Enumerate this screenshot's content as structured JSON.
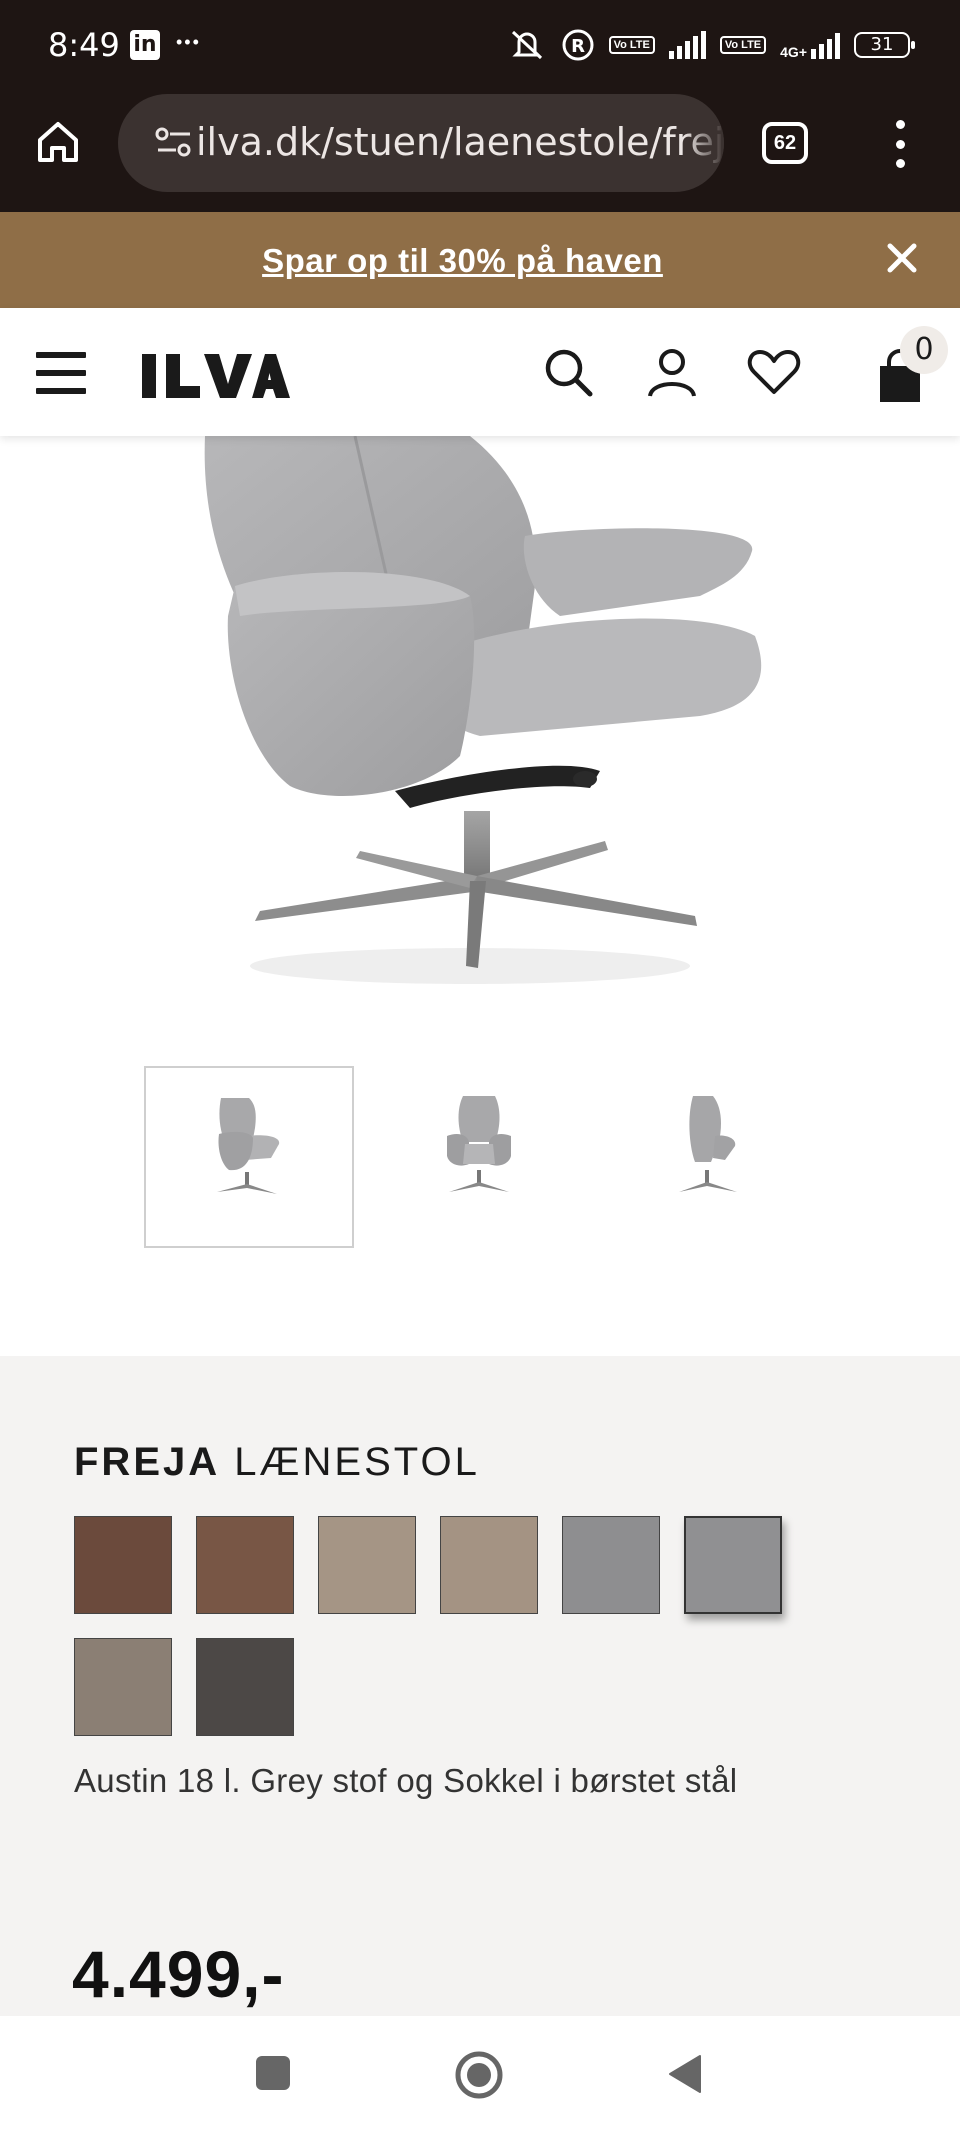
{
  "status_bar": {
    "time": "8:49",
    "linkedin_icon_label": "in",
    "more_label": "•••",
    "battery": "31",
    "network_label": "4G+",
    "volte_1": "Vo LTE",
    "volte_2": "Vo LTE"
  },
  "browser": {
    "url": "ilva.dk/stuen/laenestole/freja",
    "tab_count": "62"
  },
  "promo": {
    "text": "Spar op til 30% på haven"
  },
  "header": {
    "cart_count": "0"
  },
  "product": {
    "name_bold": "FREJA",
    "name_rest": "LÆNESTOL",
    "variant": "Austin 18 l. Grey stof og Sokkel i børstet stål",
    "price": "4.499,-",
    "swatches": [
      {
        "color": "#6b4a3c"
      },
      {
        "color": "#785645"
      },
      {
        "color": "#a59585"
      },
      {
        "color": "#a49383"
      },
      {
        "color": "#8e8e90"
      },
      {
        "color": "#909092",
        "selected": true
      },
      {
        "color": "#8b7f74"
      },
      {
        "color": "#4c4846"
      }
    ]
  },
  "colors": {
    "promo_bg": "#8f6e47",
    "chrome_bg": "#1e1513",
    "panel_bg": "#f4f3f2"
  }
}
